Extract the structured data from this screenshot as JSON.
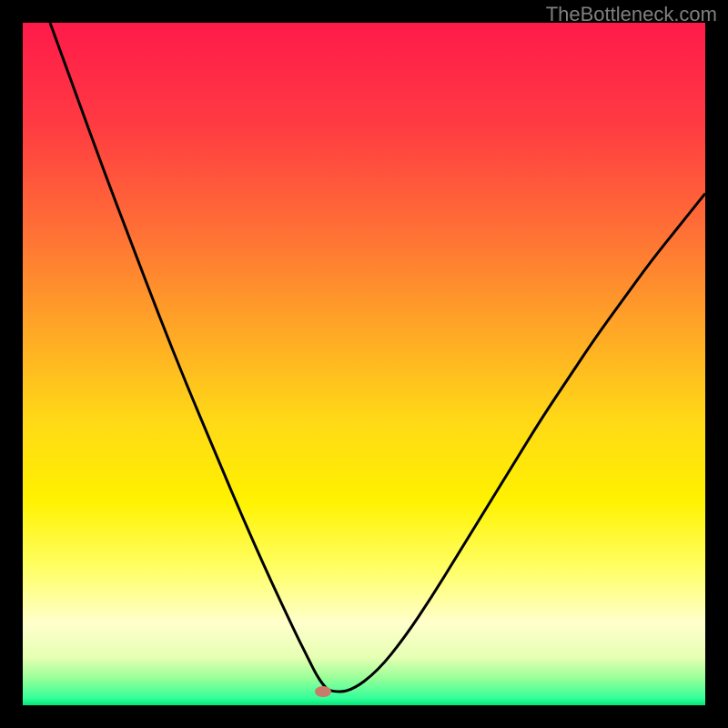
{
  "watermark": "TheBottleneck.com",
  "chart_data": {
    "type": "line",
    "title": "",
    "xlabel": "",
    "ylabel": "",
    "xlim": [
      0,
      100
    ],
    "ylim": [
      0,
      100
    ],
    "background_gradient": {
      "stops": [
        {
          "offset": 0,
          "color": "#ff1a4a"
        },
        {
          "offset": 15,
          "color": "#ff3b42"
        },
        {
          "offset": 30,
          "color": "#ff6e36"
        },
        {
          "offset": 45,
          "color": "#ffa726"
        },
        {
          "offset": 58,
          "color": "#ffd817"
        },
        {
          "offset": 70,
          "color": "#fff200"
        },
        {
          "offset": 80,
          "color": "#ffff66"
        },
        {
          "offset": 88,
          "color": "#ffffcc"
        },
        {
          "offset": 93,
          "color": "#e6ffb3"
        },
        {
          "offset": 96,
          "color": "#99ff99"
        },
        {
          "offset": 99,
          "color": "#33ff99"
        },
        {
          "offset": 100,
          "color": "#00e676"
        }
      ]
    },
    "series": [
      {
        "name": "bottleneck-curve",
        "color": "#000000",
        "x": [
          4,
          8,
          12,
          16,
          20,
          24,
          28,
          32,
          36,
          40,
          41,
          42,
          43,
          44,
          45,
          48,
          52,
          56,
          60,
          64,
          68,
          72,
          76,
          80,
          84,
          88,
          92,
          96,
          100
        ],
        "y": [
          100,
          89,
          78,
          67.5,
          57,
          47,
          37.5,
          28,
          19,
          10.5,
          8.5,
          6.5,
          4.5,
          3,
          2,
          2,
          5,
          10,
          16,
          22.5,
          29,
          35.5,
          42,
          48,
          54,
          59.5,
          65,
          70,
          75
        ]
      }
    ],
    "marker": {
      "x": 44,
      "y": 2,
      "color": "#c97a6a",
      "rx": 9,
      "ry": 6
    }
  }
}
